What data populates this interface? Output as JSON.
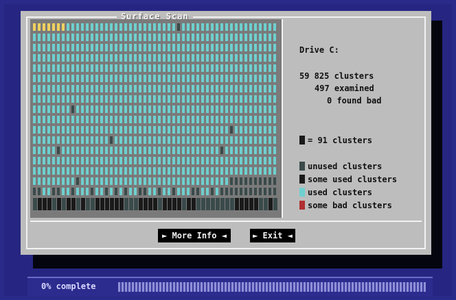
{
  "window": {
    "title": "Surface Scan"
  },
  "scan": {
    "drive_label": "Drive C:",
    "total_clusters": "59 825 clusters",
    "examined": "497 examined",
    "found_bad": "0 found bad",
    "block_legend": "= 91 clusters",
    "progress_fraction": 0.0083
  },
  "legend": [
    {
      "label": "unused clusters",
      "color": "#3a4a4a"
    },
    {
      "label": "some used clusters",
      "color": "#1a1a1a"
    },
    {
      "label": "used clusters",
      "color": "#6fcfcf"
    },
    {
      "label": "some bad clusters",
      "color": "#b03030"
    }
  ],
  "buttons": {
    "more_info": "► More Info ◄",
    "exit": "► Exit ◄"
  },
  "status": {
    "text": "0% complete",
    "percent": 0
  },
  "colors": {
    "used": "#6fcfcf",
    "unused": "#3a4a4a",
    "examined": "#f0d060",
    "panel": "#7a7a7a",
    "dialog": "#bdbdbd"
  }
}
